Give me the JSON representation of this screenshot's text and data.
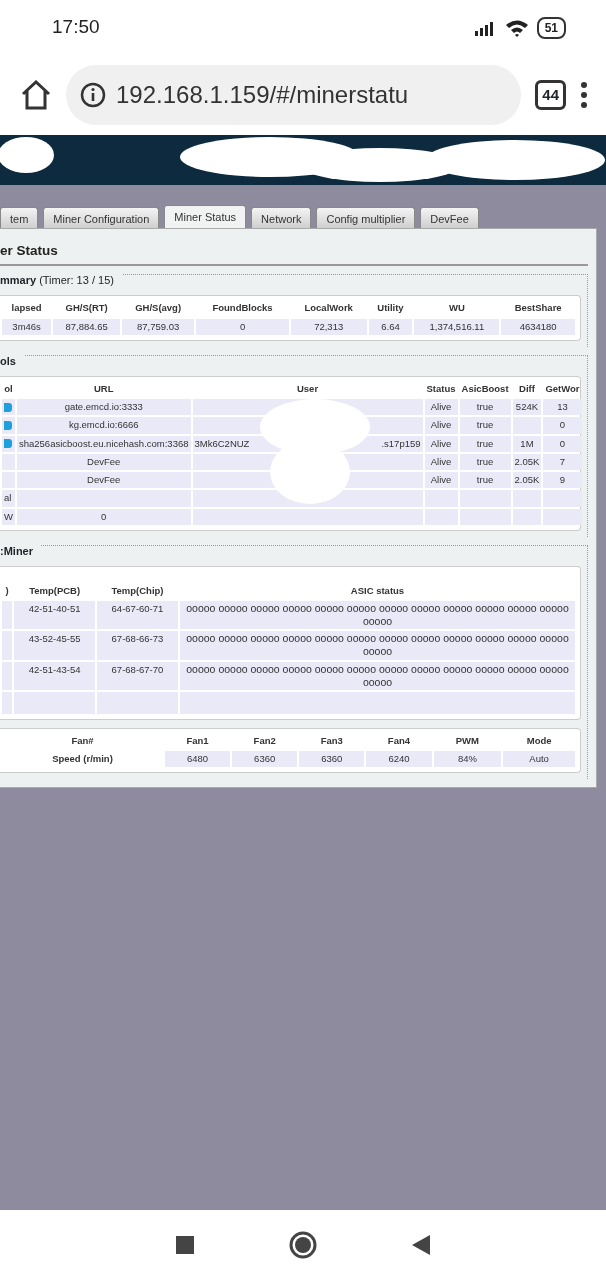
{
  "status_bar": {
    "time": "17:50",
    "battery": "51"
  },
  "browser": {
    "url": "192.168.1.159/#/minerstatu",
    "tab_count": "44"
  },
  "tabs": [
    {
      "label": "tem",
      "selected": false
    },
    {
      "label": "Miner Configuration",
      "selected": false
    },
    {
      "label": "Miner Status",
      "selected": true
    },
    {
      "label": "Network",
      "selected": false
    },
    {
      "label": "Config multiplier",
      "selected": false
    },
    {
      "label": "DevFee",
      "selected": false
    }
  ],
  "page_title": "er Status",
  "summary": {
    "legend": "mmary",
    "timer": "(Timer: 13 / 15)",
    "columns": [
      "lapsed",
      "GH/S(RT)",
      "GH/S(avg)",
      "FoundBlocks",
      "LocalWork",
      "Utility",
      "WU",
      "BestShare"
    ],
    "rows": [
      [
        "3m46s",
        "87,884.65",
        "87,759.03",
        "0",
        "72,313",
        "6.64",
        "1,374,516.11",
        "4634180"
      ]
    ]
  },
  "pools": {
    "legend": "ols",
    "columns": [
      "ol",
      "URL",
      "User",
      "Status",
      "AsicBoost",
      "Diff",
      "GetWor"
    ],
    "rows": [
      {
        "badge": true,
        "cells": [
          "",
          "gate.emcd.io:3333",
          "",
          "Alive",
          "true",
          "524K",
          "13"
        ]
      },
      {
        "badge": true,
        "cells": [
          "",
          "kg.emcd.io:6666",
          "",
          "Alive",
          "true",
          "",
          "0"
        ]
      },
      {
        "badge": true,
        "cells": [
          "",
          "sha256asicboost.eu.nicehash.com:3368",
          "3Mk6C2NUZ",
          "Alive",
          "true",
          "1M",
          "0"
        ],
        "user_end": ".s17p159"
      },
      {
        "badge": false,
        "cells": [
          "",
          "DevFee",
          "",
          "Alive",
          "true",
          "2.05K",
          "7"
        ]
      },
      {
        "badge": false,
        "cells": [
          "",
          "DevFee",
          "",
          "Alive",
          "true",
          "2.05K",
          "9"
        ]
      },
      {
        "badge": false,
        "cells": [
          "al",
          "",
          "",
          "",
          "",
          "",
          ""
        ]
      },
      {
        "badge": false,
        "cells": [
          "W",
          "0",
          "",
          "",
          "",
          "",
          ""
        ]
      }
    ]
  },
  "miner": {
    "legend": ":Miner",
    "chain_columns": [
      ")",
      "Temp(PCB)",
      "Temp(Chip)",
      "ASIC status"
    ],
    "chain_rows": [
      [
        "",
        "42-51-40-51",
        "64-67-60-71",
        "ooooo ooooo ooooo ooooo ooooo ooooo ooooo ooooo ooooo ooooo ooooo ooooo ooooo"
      ],
      [
        "",
        "43-52-45-55",
        "67-68-66-73",
        "ooooo ooooo ooooo ooooo ooooo ooooo ooooo ooooo ooooo ooooo ooooo ooooo ooooo"
      ],
      [
        "",
        "42-51-43-54",
        "67-68-67-70",
        "ooooo ooooo ooooo ooooo ooooo ooooo ooooo ooooo ooooo ooooo ooooo ooooo ooooo"
      ],
      [
        "",
        "",
        "",
        ""
      ]
    ],
    "fan_columns": [
      "Fan#",
      "Fan1",
      "Fan2",
      "Fan3",
      "Fan4",
      "PWM",
      "Mode"
    ],
    "fan_rows": [
      [
        "Speed (r/min)",
        "6480",
        "6360",
        "6360",
        "6240",
        "84%",
        "Auto"
      ]
    ]
  }
}
